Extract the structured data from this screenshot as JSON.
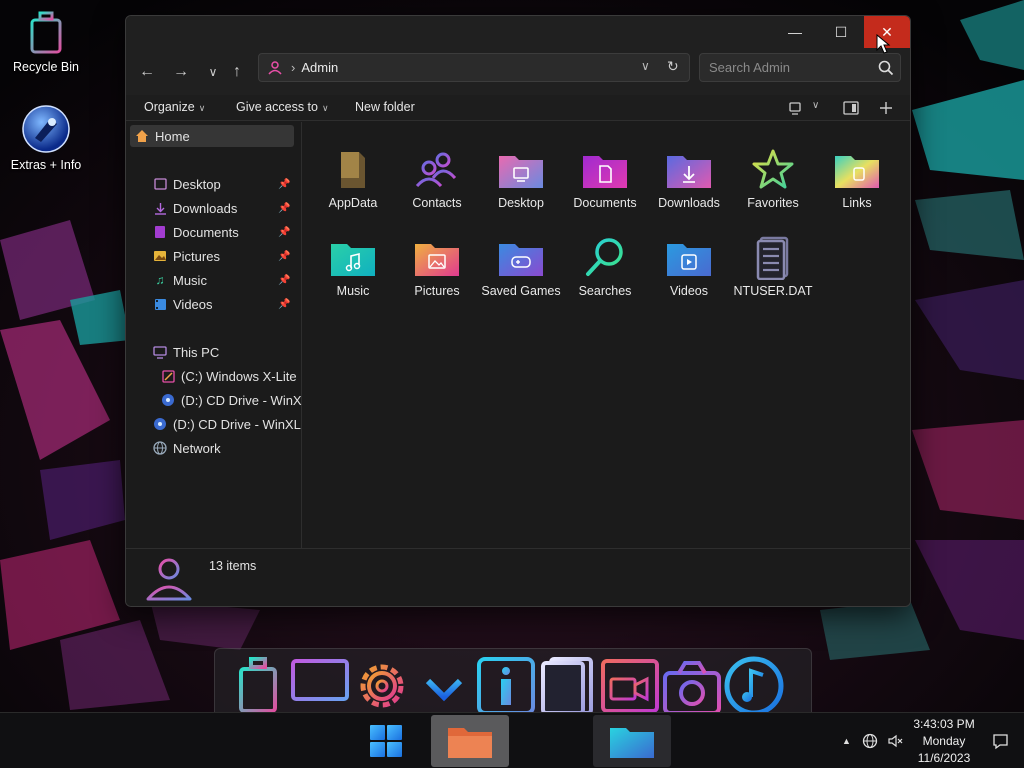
{
  "colors": {
    "accent_close": "#c42b1c",
    "window_bg": "#1b1b1b",
    "taskbar_bg": "#101012",
    "folder_gradient_cyan": "#29d3e0",
    "folder_gradient_pink": "#e84fa8"
  },
  "desktop": {
    "icons": [
      {
        "label": "Recycle Bin",
        "icon": "recycle-bin-icon"
      },
      {
        "label": "Extras + Info",
        "icon": "extras-info-icon"
      }
    ]
  },
  "window": {
    "controls": {
      "minimize": "—",
      "maximize": "☐",
      "close": "✕"
    },
    "nav": {
      "back": "←",
      "forward": "→",
      "recent": "∨",
      "up": "↑"
    },
    "address": {
      "path_separator": "›",
      "crumb": "Admin",
      "dropdown": "∨",
      "refresh": "↻"
    },
    "search": {
      "placeholder": "Search Admin"
    },
    "commands": {
      "organize": "Organize",
      "give_access": "Give access to",
      "new_folder": "New folder"
    },
    "navpane": {
      "home": "Home",
      "quick_access": [
        {
          "label": "Desktop",
          "icon": "desktop-icon",
          "pinned": true
        },
        {
          "label": "Downloads",
          "icon": "downloads-icon",
          "pinned": true
        },
        {
          "label": "Documents",
          "icon": "documents-icon",
          "pinned": true
        },
        {
          "label": "Pictures",
          "icon": "pictures-icon",
          "pinned": true
        },
        {
          "label": "Music",
          "icon": "music-icon",
          "pinned": true
        },
        {
          "label": "Videos",
          "icon": "videos-icon",
          "pinned": true
        }
      ],
      "this_pc": "This PC",
      "drives": [
        {
          "label": "(C:) Windows X-Lite",
          "icon": "drive-c-icon"
        },
        {
          "label": "(D:) CD Drive - WinX",
          "icon": "cd-drive-icon"
        },
        {
          "label": "(D:) CD Drive - WinXL",
          "icon": "cd-drive-icon"
        }
      ],
      "network": "Network"
    },
    "files": [
      {
        "label": "AppData",
        "icon": "appdata-folder-icon"
      },
      {
        "label": "Contacts",
        "icon": "contacts-icon"
      },
      {
        "label": "Desktop",
        "icon": "desktop-folder-icon"
      },
      {
        "label": "Documents",
        "icon": "documents-folder-icon"
      },
      {
        "label": "Downloads",
        "icon": "downloads-folder-icon"
      },
      {
        "label": "Favorites",
        "icon": "favorites-icon"
      },
      {
        "label": "Links",
        "icon": "links-folder-icon"
      },
      {
        "label": "Music",
        "icon": "music-folder-icon"
      },
      {
        "label": "Pictures",
        "icon": "pictures-folder-icon"
      },
      {
        "label": "Saved Games",
        "icon": "saved-games-folder-icon"
      },
      {
        "label": "Searches",
        "icon": "searches-icon"
      },
      {
        "label": "Videos",
        "icon": "videos-folder-icon"
      },
      {
        "label": "NTUSER.DAT",
        "icon": "ntuser-file-icon"
      }
    ],
    "status": {
      "item_count": "13 items"
    }
  },
  "dock": {
    "items": [
      "recycle-bin-icon",
      "monitor-icon",
      "settings-gear-icon",
      "download-icon",
      "info-icon",
      "document-list-icon",
      "video-camera-icon",
      "camera-icon",
      "music-note-icon"
    ]
  },
  "taskbar": {
    "clock": {
      "time": "3:43:03 PM",
      "day": "Monday",
      "date": "11/6/2023"
    },
    "tray_overflow": "▲"
  }
}
